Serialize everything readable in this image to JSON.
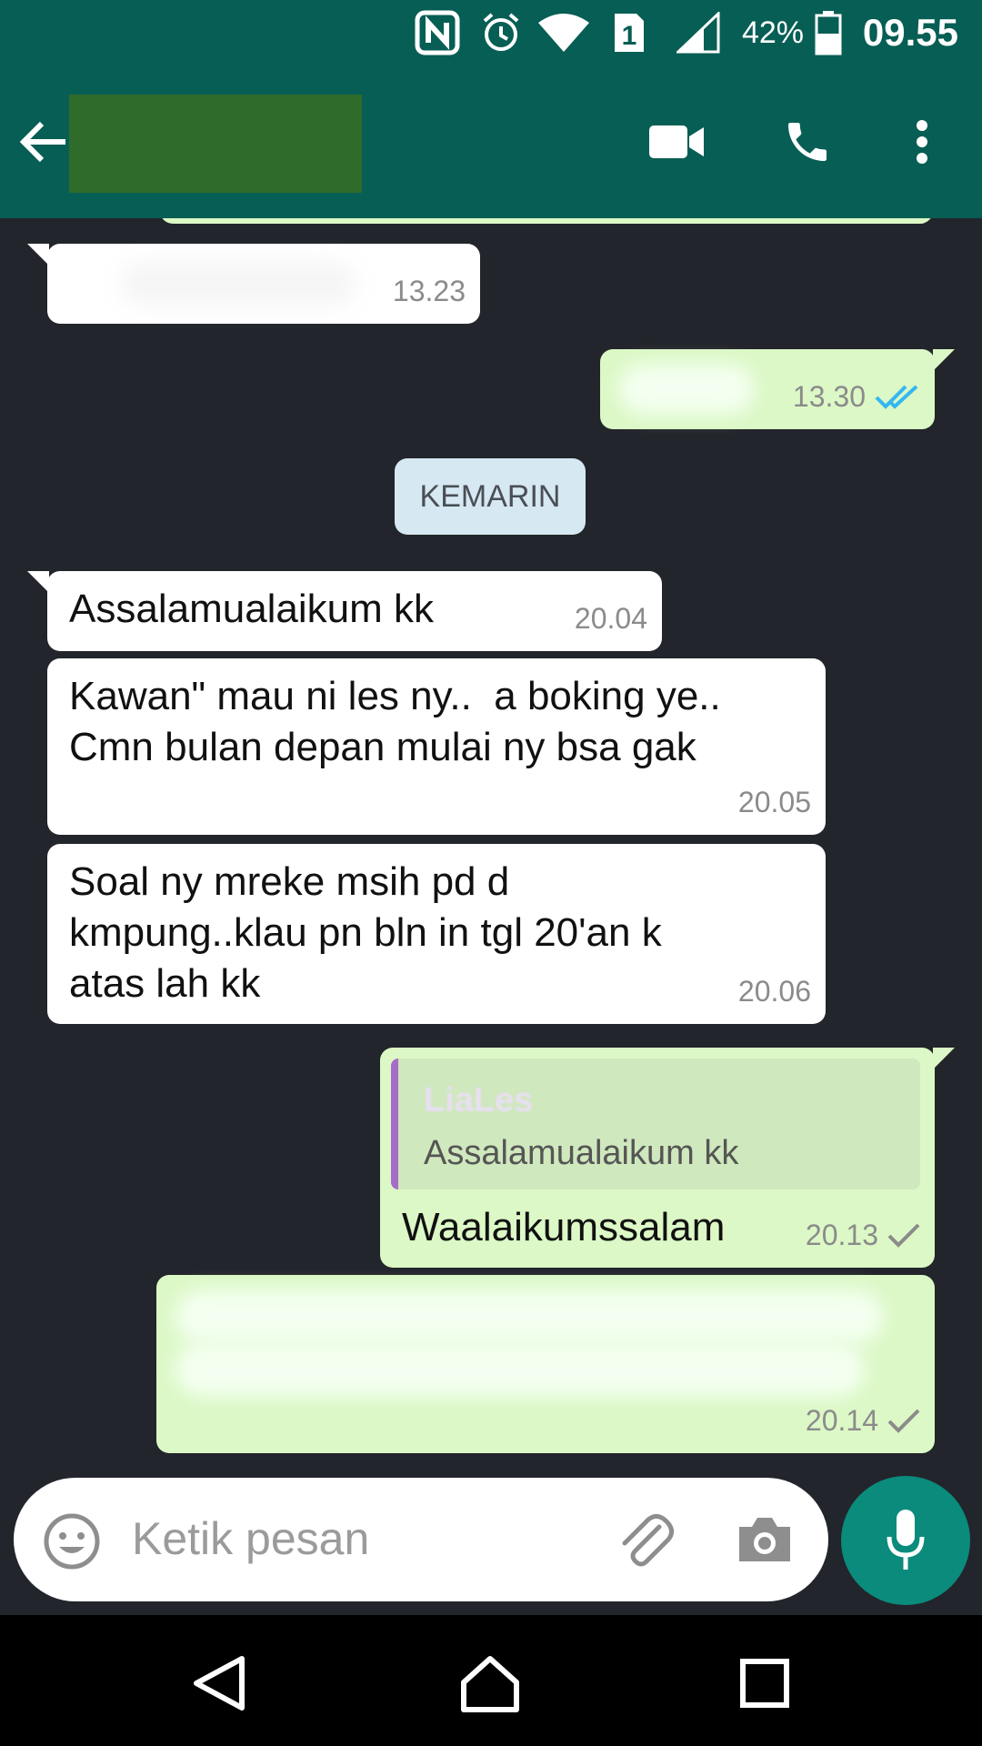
{
  "status_bar": {
    "battery_percent": "42%",
    "time": "09.55",
    "sim_label": "1"
  },
  "header": {
    "contact_name": "",
    "icons": [
      "back-arrow-icon",
      "video-call-icon",
      "phone-icon",
      "more-vert-icon"
    ]
  },
  "messages": {
    "m1_time": "13.23",
    "m2_time": "13.30",
    "date_chip": "KEMARIN",
    "m3_text": "Assalamualaikum kk",
    "m3_time": "20.04",
    "m4_text": "Kawan\" mau ni les ny..  a boking ye..\nCmn bulan depan mulai ny bsa gak",
    "m4_time": "20.05",
    "m5_text": "Soal ny mreke msih pd d\nkmpung..klau pn bln in tgl 20'an k\natas lah kk",
    "m5_time": "20.06",
    "m6_quote_name": "LiaLes",
    "m6_quote_text": "Assalamualaikum kk",
    "m6_text": "Waalaikumssalam",
    "m6_time": "20.13",
    "m7_time": "20.14"
  },
  "composer": {
    "placeholder": "Ketik pesan"
  },
  "colors": {
    "header": "#075e54",
    "outgoing_bubble": "#dcf8c6",
    "incoming_bubble": "#ffffff",
    "background": "#22252b",
    "mic_button": "#0a8b7c",
    "read_tick": "#34b7f1"
  }
}
